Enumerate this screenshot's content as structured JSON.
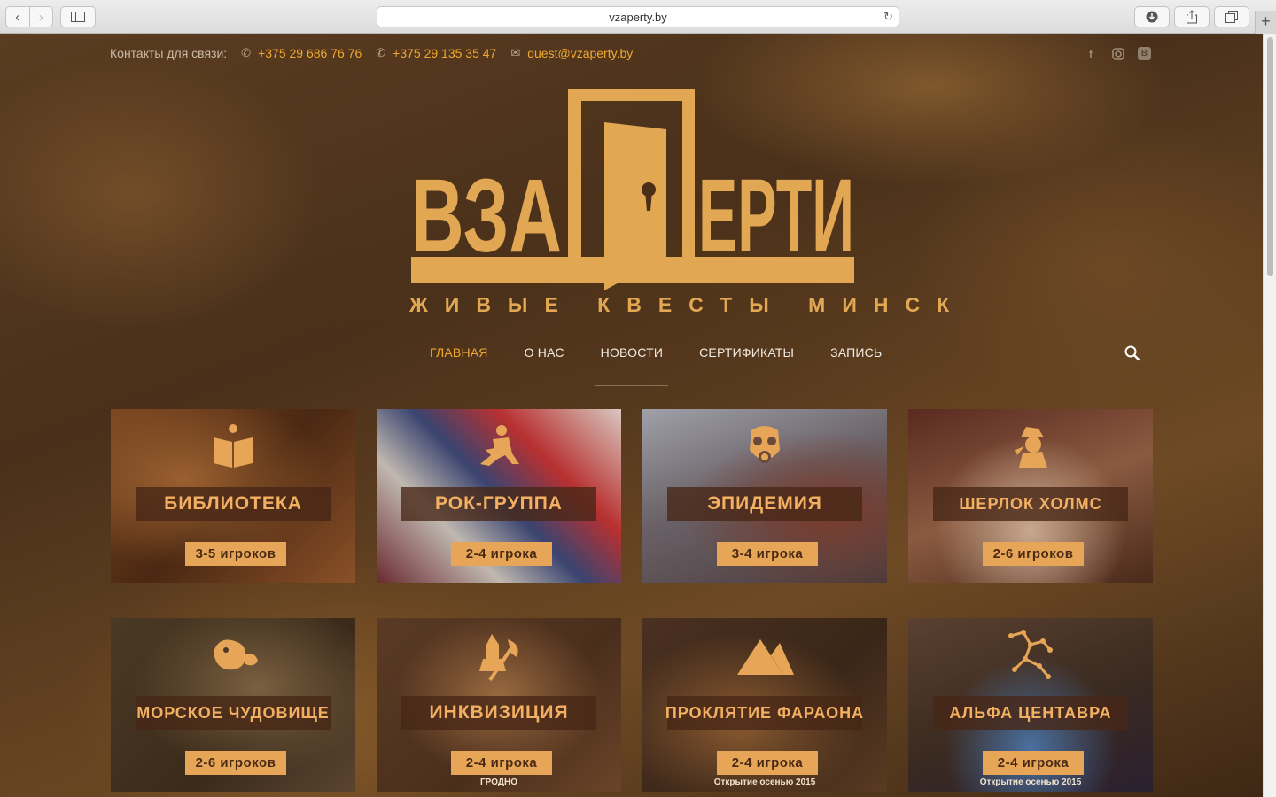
{
  "browser": {
    "url": "vzaperty.by",
    "new_tab_glyph": "+"
  },
  "contacts": {
    "label": "Контакты для связи:",
    "phone1": "+375 29 686 76 76",
    "phone2": "+375 29 135 35 47",
    "email": "quest@vzaperty.by",
    "icons": [
      "phone-icon",
      "phone-icon",
      "mail-icon"
    ]
  },
  "socials": [
    "facebook-icon",
    "instagram-icon",
    "vk-icon"
  ],
  "logo": {
    "letters_left": "ВЗА",
    "letters_right": "ЕРТИ",
    "subtitle": "ЖИВЫЕ КВЕСТЫ МИНСК",
    "color": "#e2a753"
  },
  "nav": {
    "items": [
      "ГЛАВНАЯ",
      "О НАС",
      "НОВОСТИ",
      "СЕРТИФИКАТЫ",
      "ЗАПИСЬ"
    ],
    "active": "ГЛАВНАЯ",
    "accent": "#f0a830"
  },
  "quests": [
    {
      "title": "БИБЛИОТЕКА",
      "players": "3-5 игроков",
      "icon": "book-icon",
      "note": ""
    },
    {
      "title": "РОК-ГРУППА",
      "players": "2-4 игрока",
      "icon": "guitarist-icon",
      "note": ""
    },
    {
      "title": "ЭПИДЕМИЯ",
      "players": "3-4 игрока",
      "icon": "gas-mask-icon",
      "note": ""
    },
    {
      "title": "ШЕРЛОК ХОЛМС",
      "players": "2-6 игроков",
      "icon": "sherlock-icon",
      "note": ""
    },
    {
      "title": "МОРСКОЕ ЧУДОВИЩЕ",
      "players": "2-6 игроков",
      "icon": "sea-monster-icon",
      "note": ""
    },
    {
      "title": "ИНКВИЗИЦИЯ",
      "players": "2-4 игрока",
      "icon": "executioner-icon",
      "note": "ГРОДНО"
    },
    {
      "title": "ПРОКЛЯТИЕ ФАРАОНА",
      "players": "2-4 игрока",
      "icon": "pyramid-icon",
      "note": "Открытие осенью 2015"
    },
    {
      "title": "АЛЬФА ЦЕНТАВРА",
      "players": "2-4 игрока",
      "icon": "constellation-icon",
      "note": "Открытие осенью 2015"
    }
  ]
}
